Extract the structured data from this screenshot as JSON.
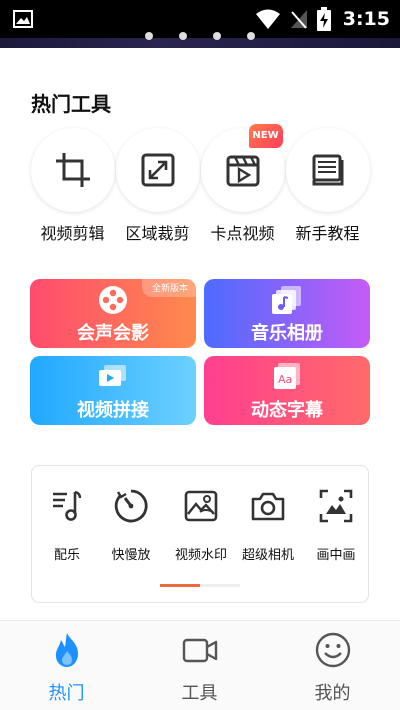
{
  "status_bar": {
    "time": "3:15"
  },
  "section": {
    "title": "热门工具"
  },
  "tools": [
    {
      "label": "视频剪辑",
      "icon": "crop-icon"
    },
    {
      "label": "区域裁剪",
      "icon": "expand-icon"
    },
    {
      "label": "卡点视频",
      "icon": "video-clapper-icon",
      "badge": "NEW"
    },
    {
      "label": "新手教程",
      "icon": "book-icon"
    }
  ],
  "features": [
    {
      "label": "会声会影",
      "icon": "film-reel-icon",
      "tag": "全新版本",
      "color_from": "#ff4b6e",
      "color_to": "#ff8a4c"
    },
    {
      "label": "音乐相册",
      "icon": "music-album-icon",
      "color_from": "#4d6bff",
      "color_to": "#c45cf5"
    },
    {
      "label": "视频拼接",
      "icon": "video-stack-icon",
      "color_from": "#20a8ff",
      "color_to": "#6dd0ff"
    },
    {
      "label": "动态字幕",
      "icon": "subtitle-icon",
      "color_from": "#ff3f8f",
      "color_to": "#ff6a6a"
    }
  ],
  "mini_tools": [
    {
      "label": "配乐",
      "icon": "music-note-icon"
    },
    {
      "label": "快慢放",
      "icon": "speed-dial-icon"
    },
    {
      "label": "视频水印",
      "icon": "watermark-icon"
    },
    {
      "label": "超级相机",
      "icon": "camera-icon"
    },
    {
      "label": "画中画",
      "icon": "picture-in-picture-icon"
    }
  ],
  "bottom_nav": [
    {
      "label": "热门",
      "icon": "flame-icon",
      "active": true
    },
    {
      "label": "工具",
      "icon": "video-camera-icon",
      "active": false
    },
    {
      "label": "我的",
      "icon": "smiley-icon",
      "active": false
    }
  ],
  "colors": {
    "accent": "#1e90ff",
    "inactive": "#555555"
  }
}
